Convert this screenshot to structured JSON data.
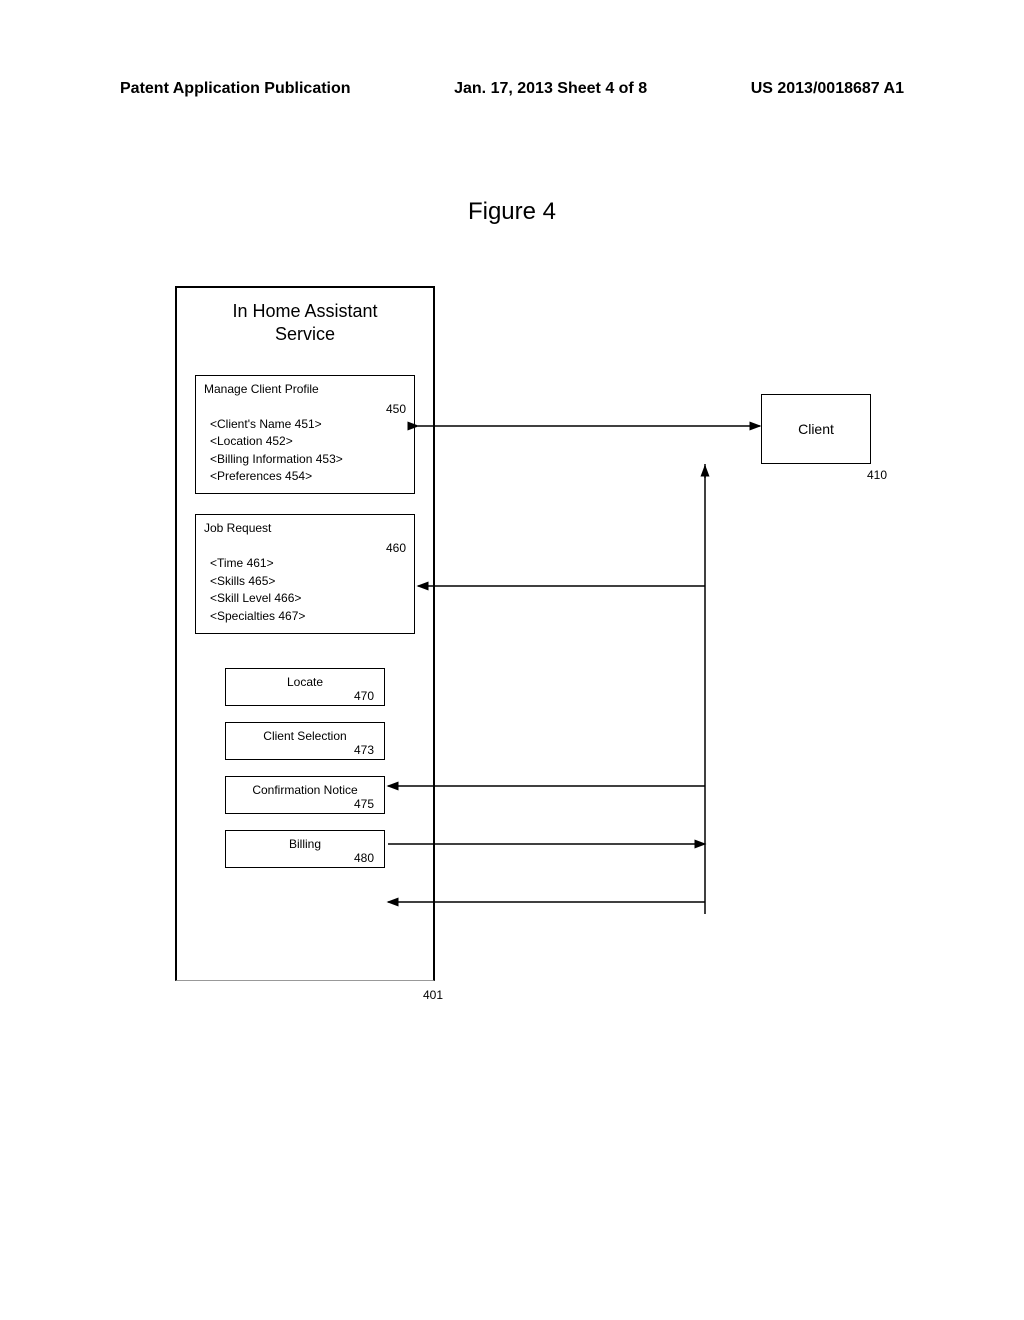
{
  "header": {
    "left": "Patent Application Publication",
    "center": "Jan. 17, 2013  Sheet 4 of 8",
    "right": "US 2013/0018687 A1"
  },
  "figure": {
    "title": "Figure 4"
  },
  "service": {
    "title_line1": "In Home Assistant",
    "title_line2": "Service",
    "bottom_ref": "401"
  },
  "profile_box": {
    "title": "Manage Client Profile",
    "num": "450",
    "fields": [
      "<Client's Name 451>",
      "<Location 452>",
      "<Billing Information 453>",
      "<Preferences 454>"
    ]
  },
  "job_box": {
    "title": "Job Request",
    "num": "460",
    "fields": [
      "<Time 461>",
      "<Skills 465>",
      "<Skill Level 466>",
      "<Specialties 467>"
    ]
  },
  "steps": {
    "locate": {
      "label": "Locate",
      "num": "470"
    },
    "selection": {
      "label": "Client Selection",
      "num": "473"
    },
    "confirm": {
      "label": "Confirmation Notice",
      "num": "475"
    },
    "billing": {
      "label": "Billing",
      "num": "480"
    }
  },
  "client": {
    "label": "Client",
    "ref": "410"
  }
}
